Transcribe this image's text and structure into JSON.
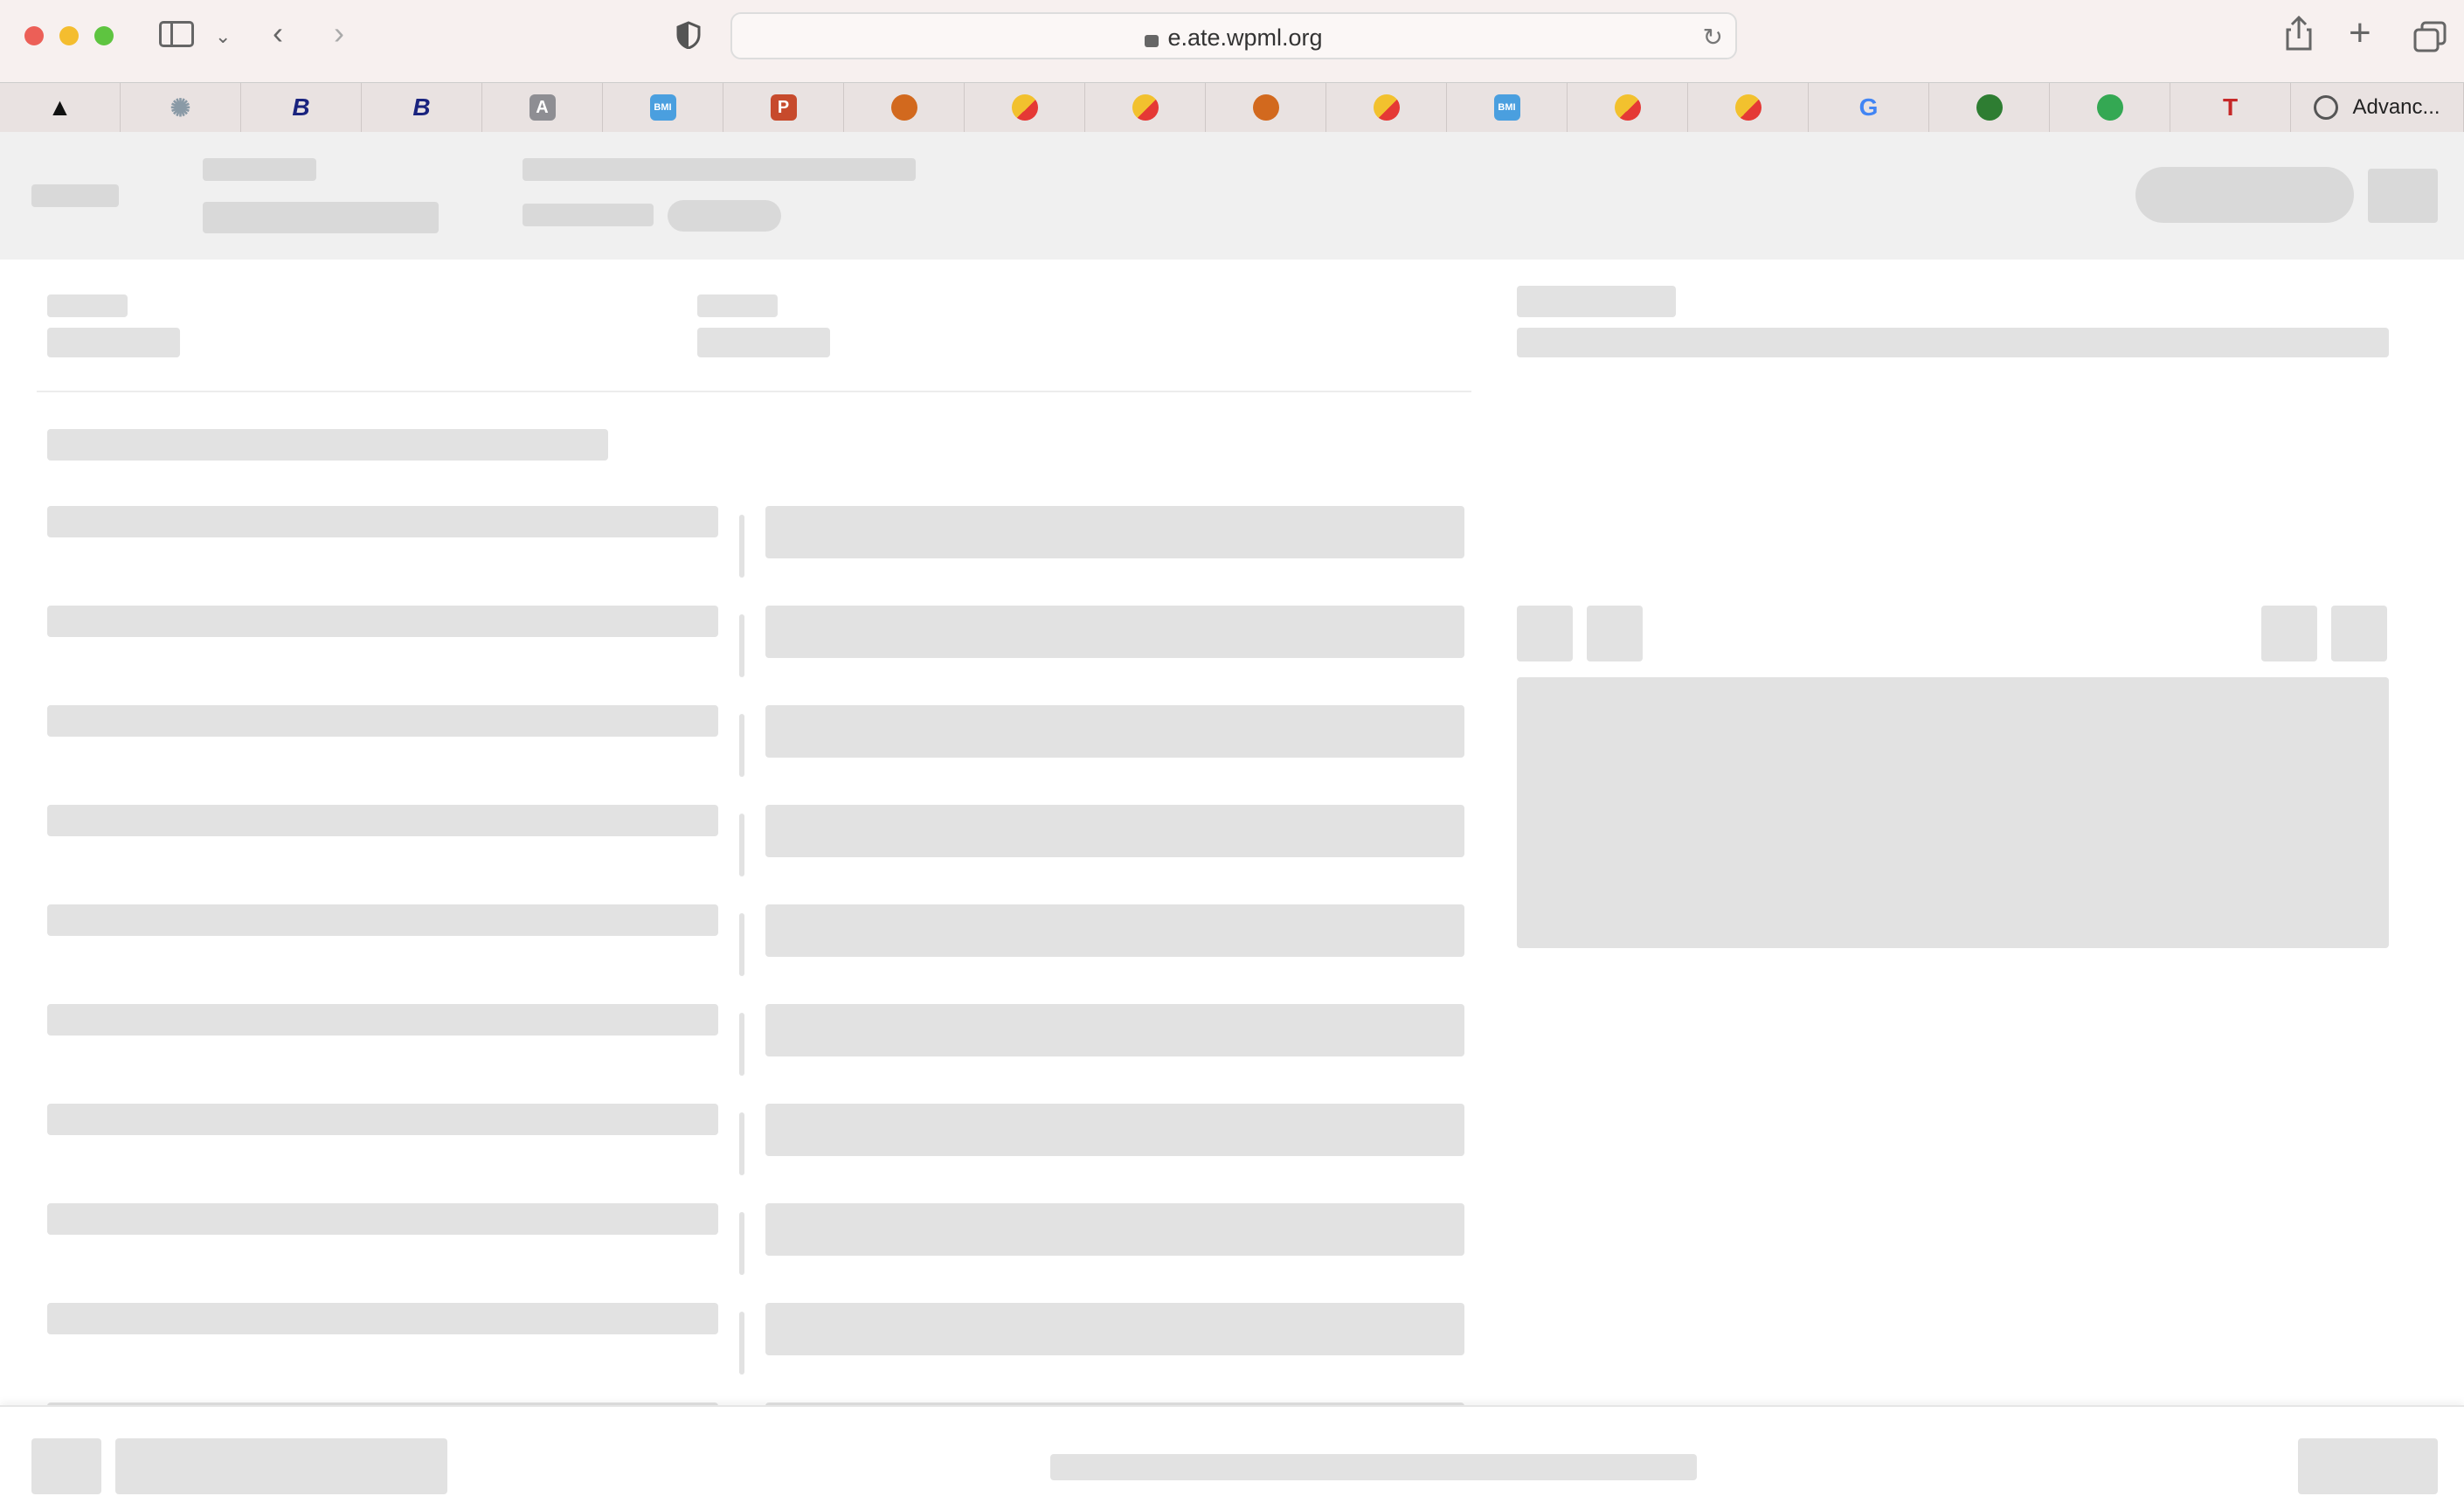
{
  "browser": {
    "url": "e.ate.wpml.org",
    "window_controls": [
      "close",
      "minimize",
      "zoom"
    ],
    "toolbar_icons": [
      "sidebar-icon",
      "chevron-down-icon",
      "back-icon",
      "forward-icon",
      "shield-icon",
      "lock-icon",
      "reload-icon",
      "share-icon",
      "plus-icon",
      "tabs-overview-icon"
    ],
    "tabs": [
      {
        "icon": "triangle-logo-icon",
        "color": "#111111",
        "glyph": "▲"
      },
      {
        "icon": "globe-icon",
        "color": "#8a9aa6",
        "glyph": "✺"
      },
      {
        "icon": "b-logo-icon",
        "color": "#1a237e",
        "glyph": "B"
      },
      {
        "icon": "b-logo-icon",
        "color": "#1a237e",
        "glyph": "B"
      },
      {
        "icon": "a-logo-icon",
        "color": "#8e8e93",
        "glyph": "A"
      },
      {
        "icon": "bmi-logo-icon",
        "color": "#4a9fdf",
        "glyph": "BMI"
      },
      {
        "icon": "powerpoint-icon",
        "color": "#c74a2c",
        "glyph": "P"
      },
      {
        "icon": "orange-ball-icon",
        "color": "#d2691e",
        "glyph": ""
      },
      {
        "icon": "yellow-red-icon",
        "color": "#f2c12e",
        "glyph": ""
      },
      {
        "icon": "yellow-red-icon",
        "color": "#f2c12e",
        "glyph": ""
      },
      {
        "icon": "orange-ball-icon",
        "color": "#d2691e",
        "glyph": ""
      },
      {
        "icon": "yellow-red-icon",
        "color": "#f2c12e",
        "glyph": ""
      },
      {
        "icon": "bmi-logo-icon",
        "color": "#4a9fdf",
        "glyph": "BMI"
      },
      {
        "icon": "yellow-red-icon",
        "color": "#f2c12e",
        "glyph": ""
      },
      {
        "icon": "yellow-red-icon",
        "color": "#f2c12e",
        "glyph": ""
      },
      {
        "icon": "google-icon",
        "color": "#4285f4",
        "glyph": "G"
      },
      {
        "icon": "leaf-icon",
        "color": "#2e7d32",
        "glyph": ""
      },
      {
        "icon": "maps-pin-icon",
        "color": "#34a853",
        "glyph": ""
      },
      {
        "icon": "t-logo-icon",
        "color": "#c62828",
        "glyph": "T"
      },
      {
        "icon": "loading-icon",
        "color": "#555555",
        "glyph": "",
        "label": "Advanc..."
      }
    ]
  },
  "colors": {
    "skeleton": "#e2e2e2",
    "header_bg": "#f0f0f0",
    "chrome_bg": "#f7f0ef"
  }
}
